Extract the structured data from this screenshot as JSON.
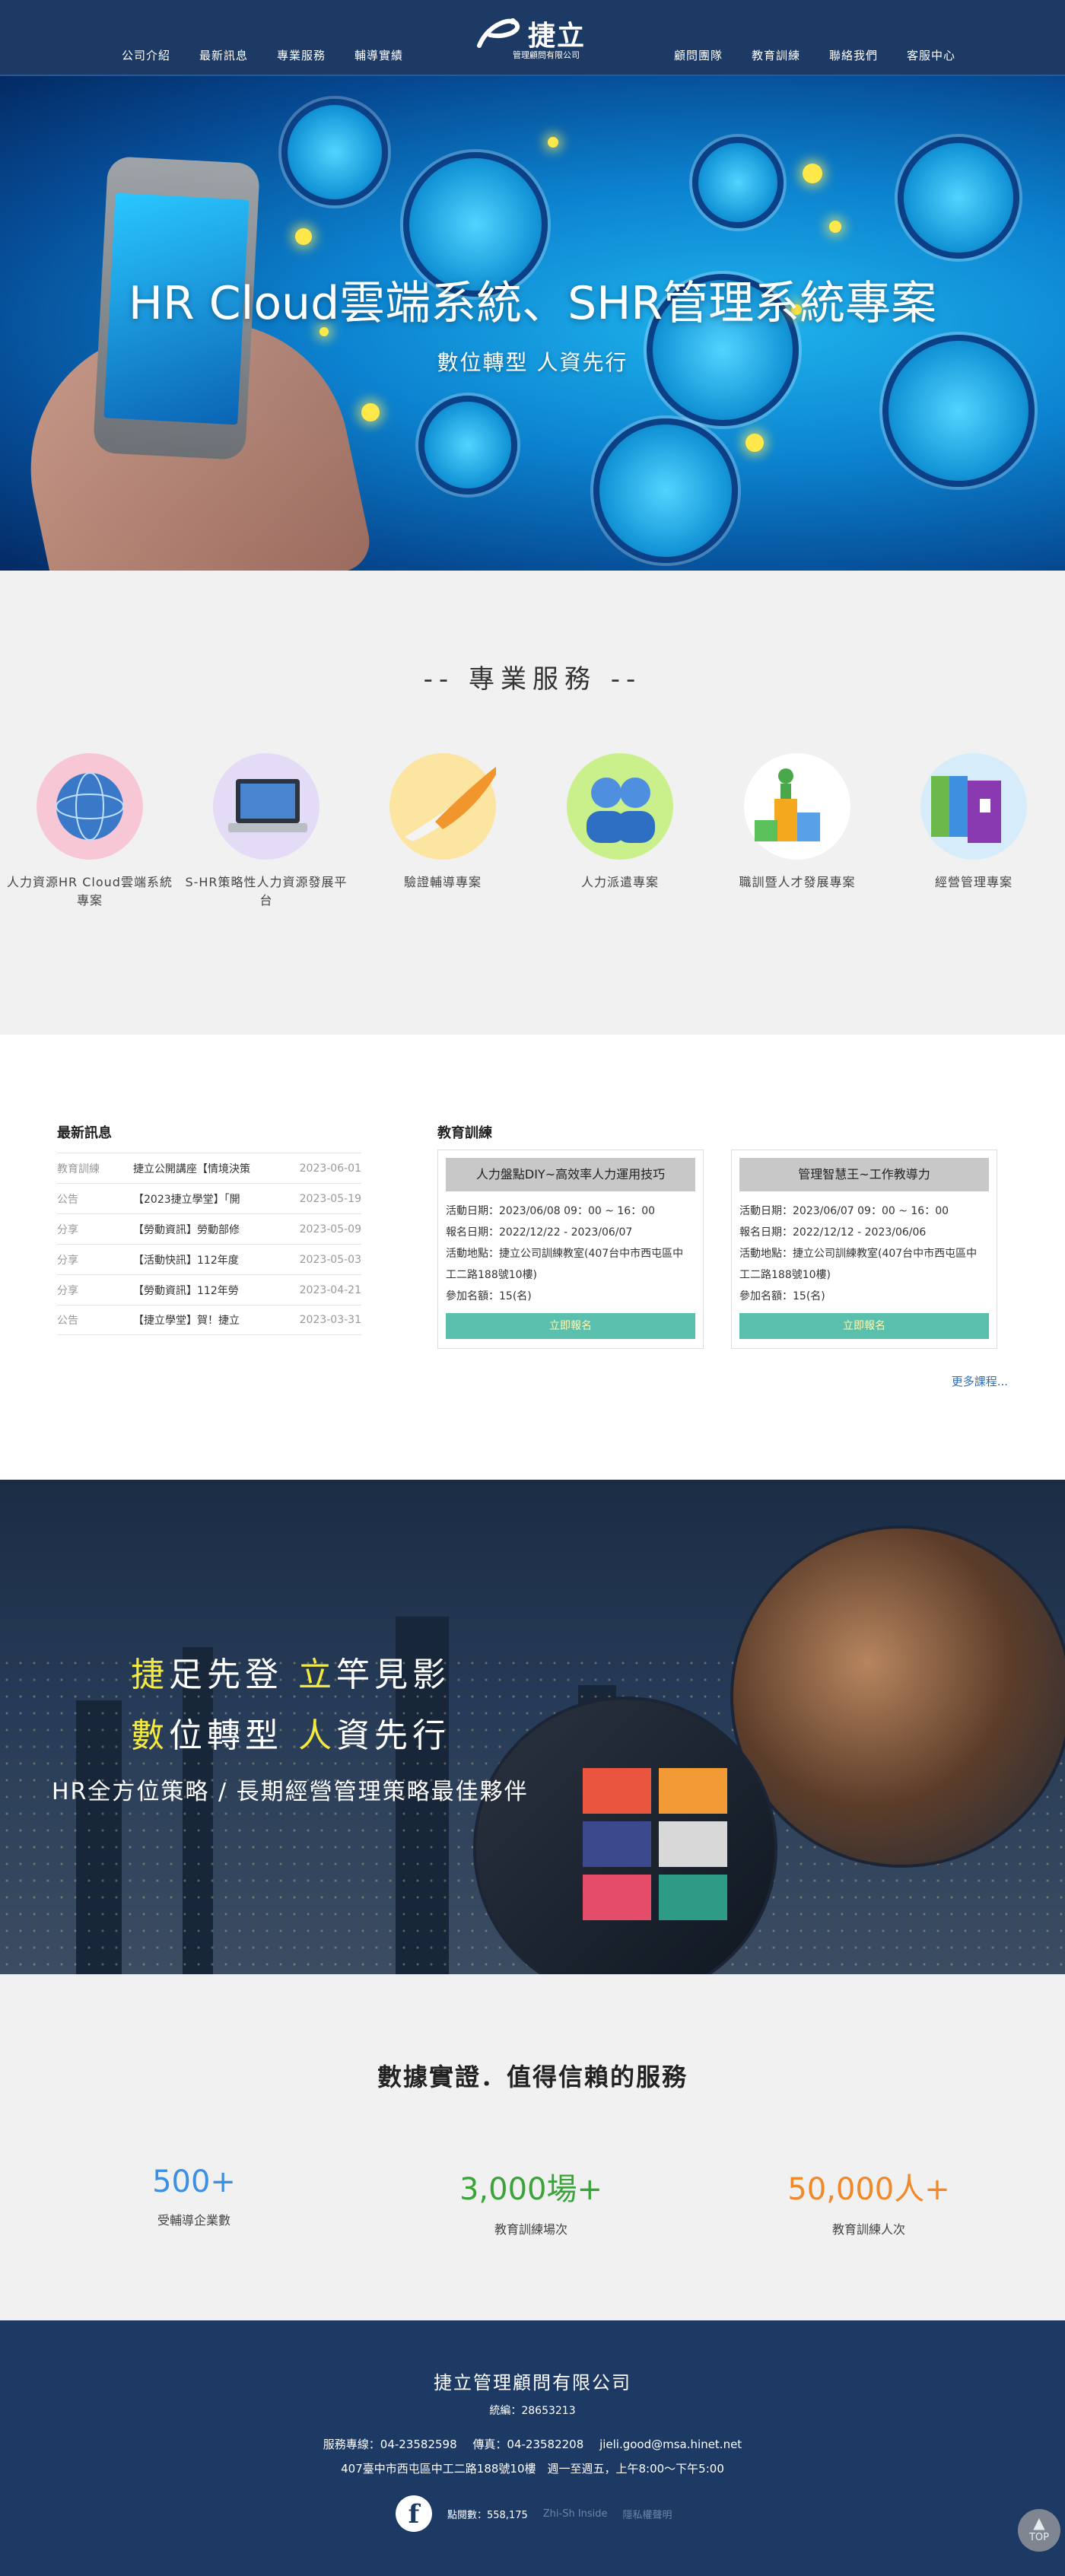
{
  "nav": {
    "left": [
      "公司介紹",
      "最新訊息",
      "專業服務",
      "輔導實績"
    ],
    "right": [
      "顧問團隊",
      "教育訓練",
      "聯絡我們",
      "客服中心"
    ],
    "logo": {
      "name": "捷立",
      "sub": "管理顧問有限公司"
    }
  },
  "hero": {
    "title": "HR Cloud雲端系統、SHR管理系統專案",
    "subtitle": "數位轉型 人資先行"
  },
  "services": {
    "title": "--    專業服務    --",
    "items": [
      {
        "label": "人力資源HR Cloud雲端系統專案",
        "icon": "globe-icon"
      },
      {
        "label": "S-HR策略性人力資源發展平台",
        "icon": "laptop-icon"
      },
      {
        "label": "驗證輔導專案",
        "icon": "quill-pen-icon"
      },
      {
        "label": "人力派遣專案",
        "icon": "people-icon"
      },
      {
        "label": "職訓暨人才發展專案",
        "icon": "podium-icon"
      },
      {
        "label": "經營管理專案",
        "icon": "binders-icon"
      }
    ]
  },
  "news": {
    "title": "最新訊息",
    "rows": [
      {
        "cat": "教育訓練",
        "title": "捷立公開講座【情境決策",
        "date": "2023-06-01"
      },
      {
        "cat": "公告",
        "title": "【2023捷立學堂】「開",
        "date": "2023-05-19"
      },
      {
        "cat": "分享",
        "title": "【勞動資訊】勞動部修",
        "date": "2023-05-09"
      },
      {
        "cat": "分享",
        "title": "【活動快訊】112年度",
        "date": "2023-05-03"
      },
      {
        "cat": "分享",
        "title": "【勞動資訊】112年勞",
        "date": "2023-04-21"
      },
      {
        "cat": "公告",
        "title": "【捷立學堂】賀！捷立",
        "date": "2023-03-31"
      }
    ]
  },
  "training": {
    "title": "教育訓練",
    "courses": [
      {
        "title": "人力盤點DIY~高效率人力運用技巧",
        "date": "活動日期：2023/06/08 09：00 ~ 16：00",
        "signup": "報名日期：2022/12/22 - 2023/06/07",
        "place1": "活動地點：捷立公司訓練教室(407台中市西屯區中",
        "place2": "工二路188號10樓)",
        "count": "參加名額：15(名)",
        "button": "立即報名"
      },
      {
        "title": "管理智慧王~工作教導力",
        "date": "活動日期：2023/06/07 09：00 ~ 16：00",
        "signup": "報名日期：2022/12/12 - 2023/06/06",
        "place1": "活動地點：捷立公司訓練教室(407台中市西屯區中",
        "place2": "工二路188號10樓)",
        "count": "參加名額：15(名)",
        "button": "立即報名"
      }
    ],
    "more": "更多課程..."
  },
  "banner2": {
    "l1a": "捷",
    "l1b": "足先登  ",
    "l1c": "立",
    "l1d": "竿見影",
    "l2a": "數",
    "l2b": "位轉型  ",
    "l2c": "人",
    "l2d": "資先行",
    "line3": "HR全方位策略 / 長期經營管理策略最佳夥伴"
  },
  "stats": {
    "title": "數據實證．值得信賴的服務",
    "items": [
      {
        "num": "500+",
        "label": "受輔導企業數",
        "color": "#3d8fe0"
      },
      {
        "num": "3,000場+",
        "label": "教育訓練場次",
        "color": "#3aa33a"
      },
      {
        "num": "50,000人+",
        "label": "教育訓練人次",
        "color": "#f0892a"
      }
    ]
  },
  "footer": {
    "company": "捷立管理顧問有限公司",
    "tax": "統編：28653213",
    "phone": "服務專線：04-23582598",
    "fax": "傳真：04-23582208",
    "email": "jieli.good@msa.hinet.net",
    "address": "407臺中市西屯區中工二路188號10樓　週一至週五，上午8:00～下午5:00",
    "visits": "點閱數：558,175",
    "credit": "Zhi-Sh Inside",
    "privacy": "隱私權聲明",
    "fb": "f"
  },
  "top_button": "TOP"
}
